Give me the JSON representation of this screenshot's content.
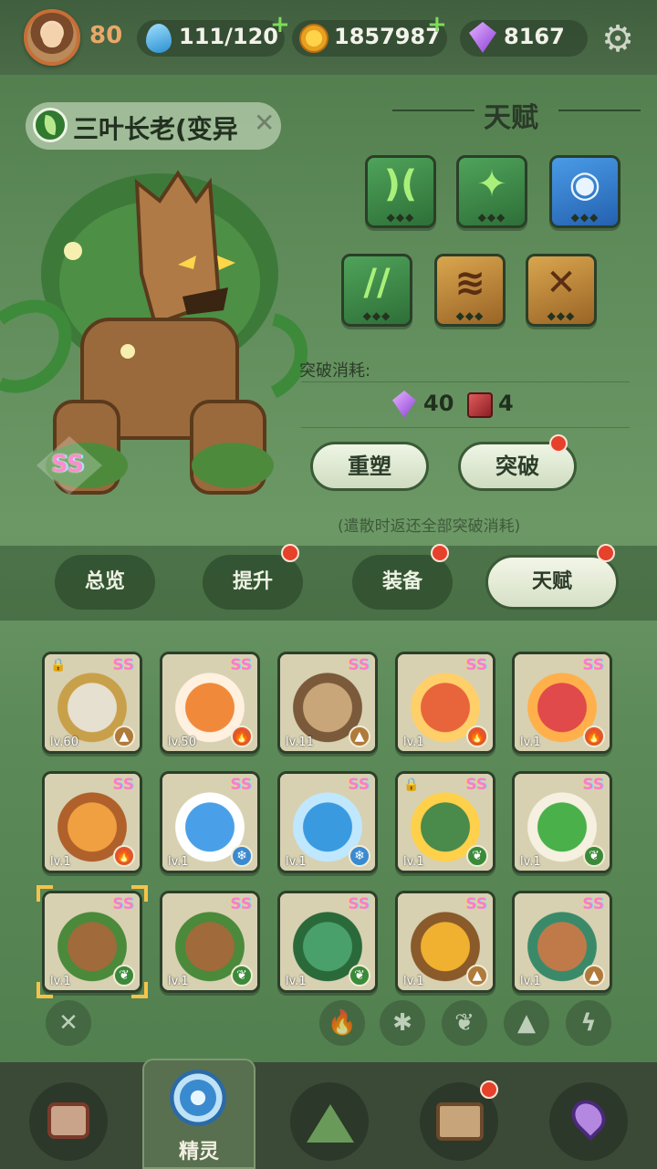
{
  "topbar": {
    "level": "80",
    "stamina": "111/120",
    "coins": "1857987",
    "gems": "8167",
    "plus": "+"
  },
  "pet": {
    "name": "三叶长老(变异",
    "rarity": "SS",
    "element": "leaf"
  },
  "talent": {
    "title": "天赋",
    "cost_label": "突破消耗:",
    "cost_gems": "40",
    "cost_books": "4",
    "reshape_button": "重塑",
    "breakthrough_button": "突破",
    "note": "(遣散时返还全部突破消耗)",
    "slots": [
      {
        "color": "green",
        "symbol": ")(",
        "dots": "◆◆◆"
      },
      {
        "color": "green",
        "symbol": "✦",
        "dots": "◆◆◆"
      },
      {
        "color": "blue",
        "symbol": "◉",
        "dots": "◆◆◆"
      },
      {
        "color": "green",
        "symbol": "//",
        "dots": "◆◆◆"
      },
      {
        "color": "orange",
        "symbol": "≋",
        "dots": "◆◆◆"
      },
      {
        "color": "orange",
        "symbol": "✕",
        "dots": "◆◆◆"
      }
    ]
  },
  "tabs": [
    {
      "label": "总览",
      "active": false,
      "dot": false
    },
    {
      "label": "提升",
      "active": false,
      "dot": true
    },
    {
      "label": "装备",
      "active": false,
      "dot": true
    },
    {
      "label": "天赋",
      "active": true,
      "dot": true
    }
  ],
  "grid": [
    {
      "lv": "lv.60",
      "ss": "SS",
      "elem": "earth",
      "locked": true
    },
    {
      "lv": "lv.50",
      "ss": "SS",
      "elem": "fire",
      "locked": false
    },
    {
      "lv": "lv.11",
      "ss": "SS",
      "elem": "earth",
      "locked": false
    },
    {
      "lv": "lv.1",
      "ss": "SS",
      "elem": "fire",
      "locked": false
    },
    {
      "lv": "lv.1",
      "ss": "SS",
      "elem": "fire",
      "locked": false
    },
    {
      "lv": "lv.1",
      "ss": "SS",
      "elem": "fire",
      "locked": false
    },
    {
      "lv": "lv.1",
      "ss": "SS",
      "elem": "water",
      "locked": false
    },
    {
      "lv": "lv.1",
      "ss": "SS",
      "elem": "water",
      "locked": false
    },
    {
      "lv": "lv.1",
      "ss": "SS",
      "elem": "leaf",
      "locked": true
    },
    {
      "lv": "lv.1",
      "ss": "SS",
      "elem": "leaf",
      "locked": false
    },
    {
      "lv": "lv.1",
      "ss": "SS",
      "elem": "leaf",
      "locked": false
    },
    {
      "lv": "lv.1",
      "ss": "SS",
      "elem": "leaf",
      "locked": false
    },
    {
      "lv": "lv.1",
      "ss": "SS",
      "elem": "leaf",
      "locked": false
    },
    {
      "lv": "lv.1",
      "ss": "SS",
      "elem": "earth",
      "locked": false
    },
    {
      "lv": "lv.1",
      "ss": "SS",
      "elem": "earth",
      "locked": false
    }
  ],
  "filters": [
    "✕",
    "fire",
    "water",
    "leaf",
    "earth",
    "lightning"
  ],
  "nav": {
    "active_label": "精灵",
    "items": [
      "home-icon",
      "pet-icon",
      "mountain-icon",
      "chest-icon",
      "map-pin-icon"
    ]
  },
  "colors": {
    "accent": "#3a5a36",
    "reddot": "#e5412b",
    "selection": "#f5c34a"
  }
}
